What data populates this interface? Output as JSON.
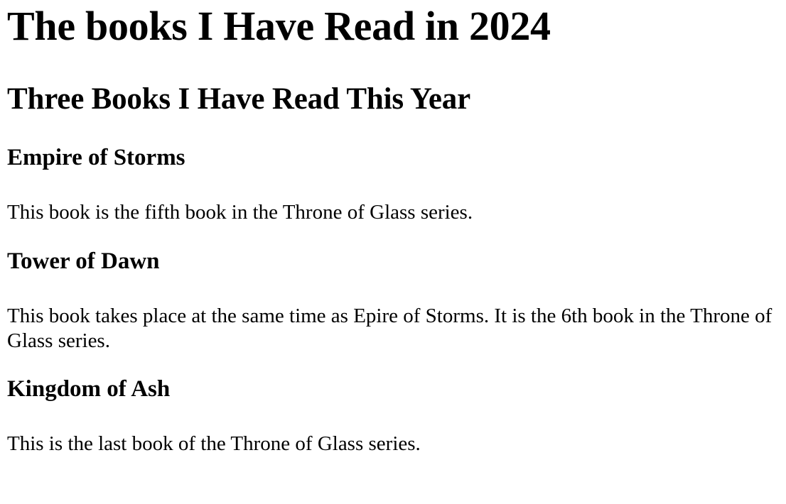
{
  "page": {
    "title": "The books I Have Read in 2024",
    "subtitle": "Three Books I Have Read This Year",
    "books": [
      {
        "title": "Empire of Storms",
        "description": "This book is the fifth book in the Throne of Glass series."
      },
      {
        "title": "Tower of Dawn",
        "description": "This book takes place at the same time as Epire of Storms. It is the 6th book in the Throne of Glass series."
      },
      {
        "title": "Kingdom of Ash",
        "description": "This is the last book of the Throne of Glass series."
      }
    ]
  }
}
